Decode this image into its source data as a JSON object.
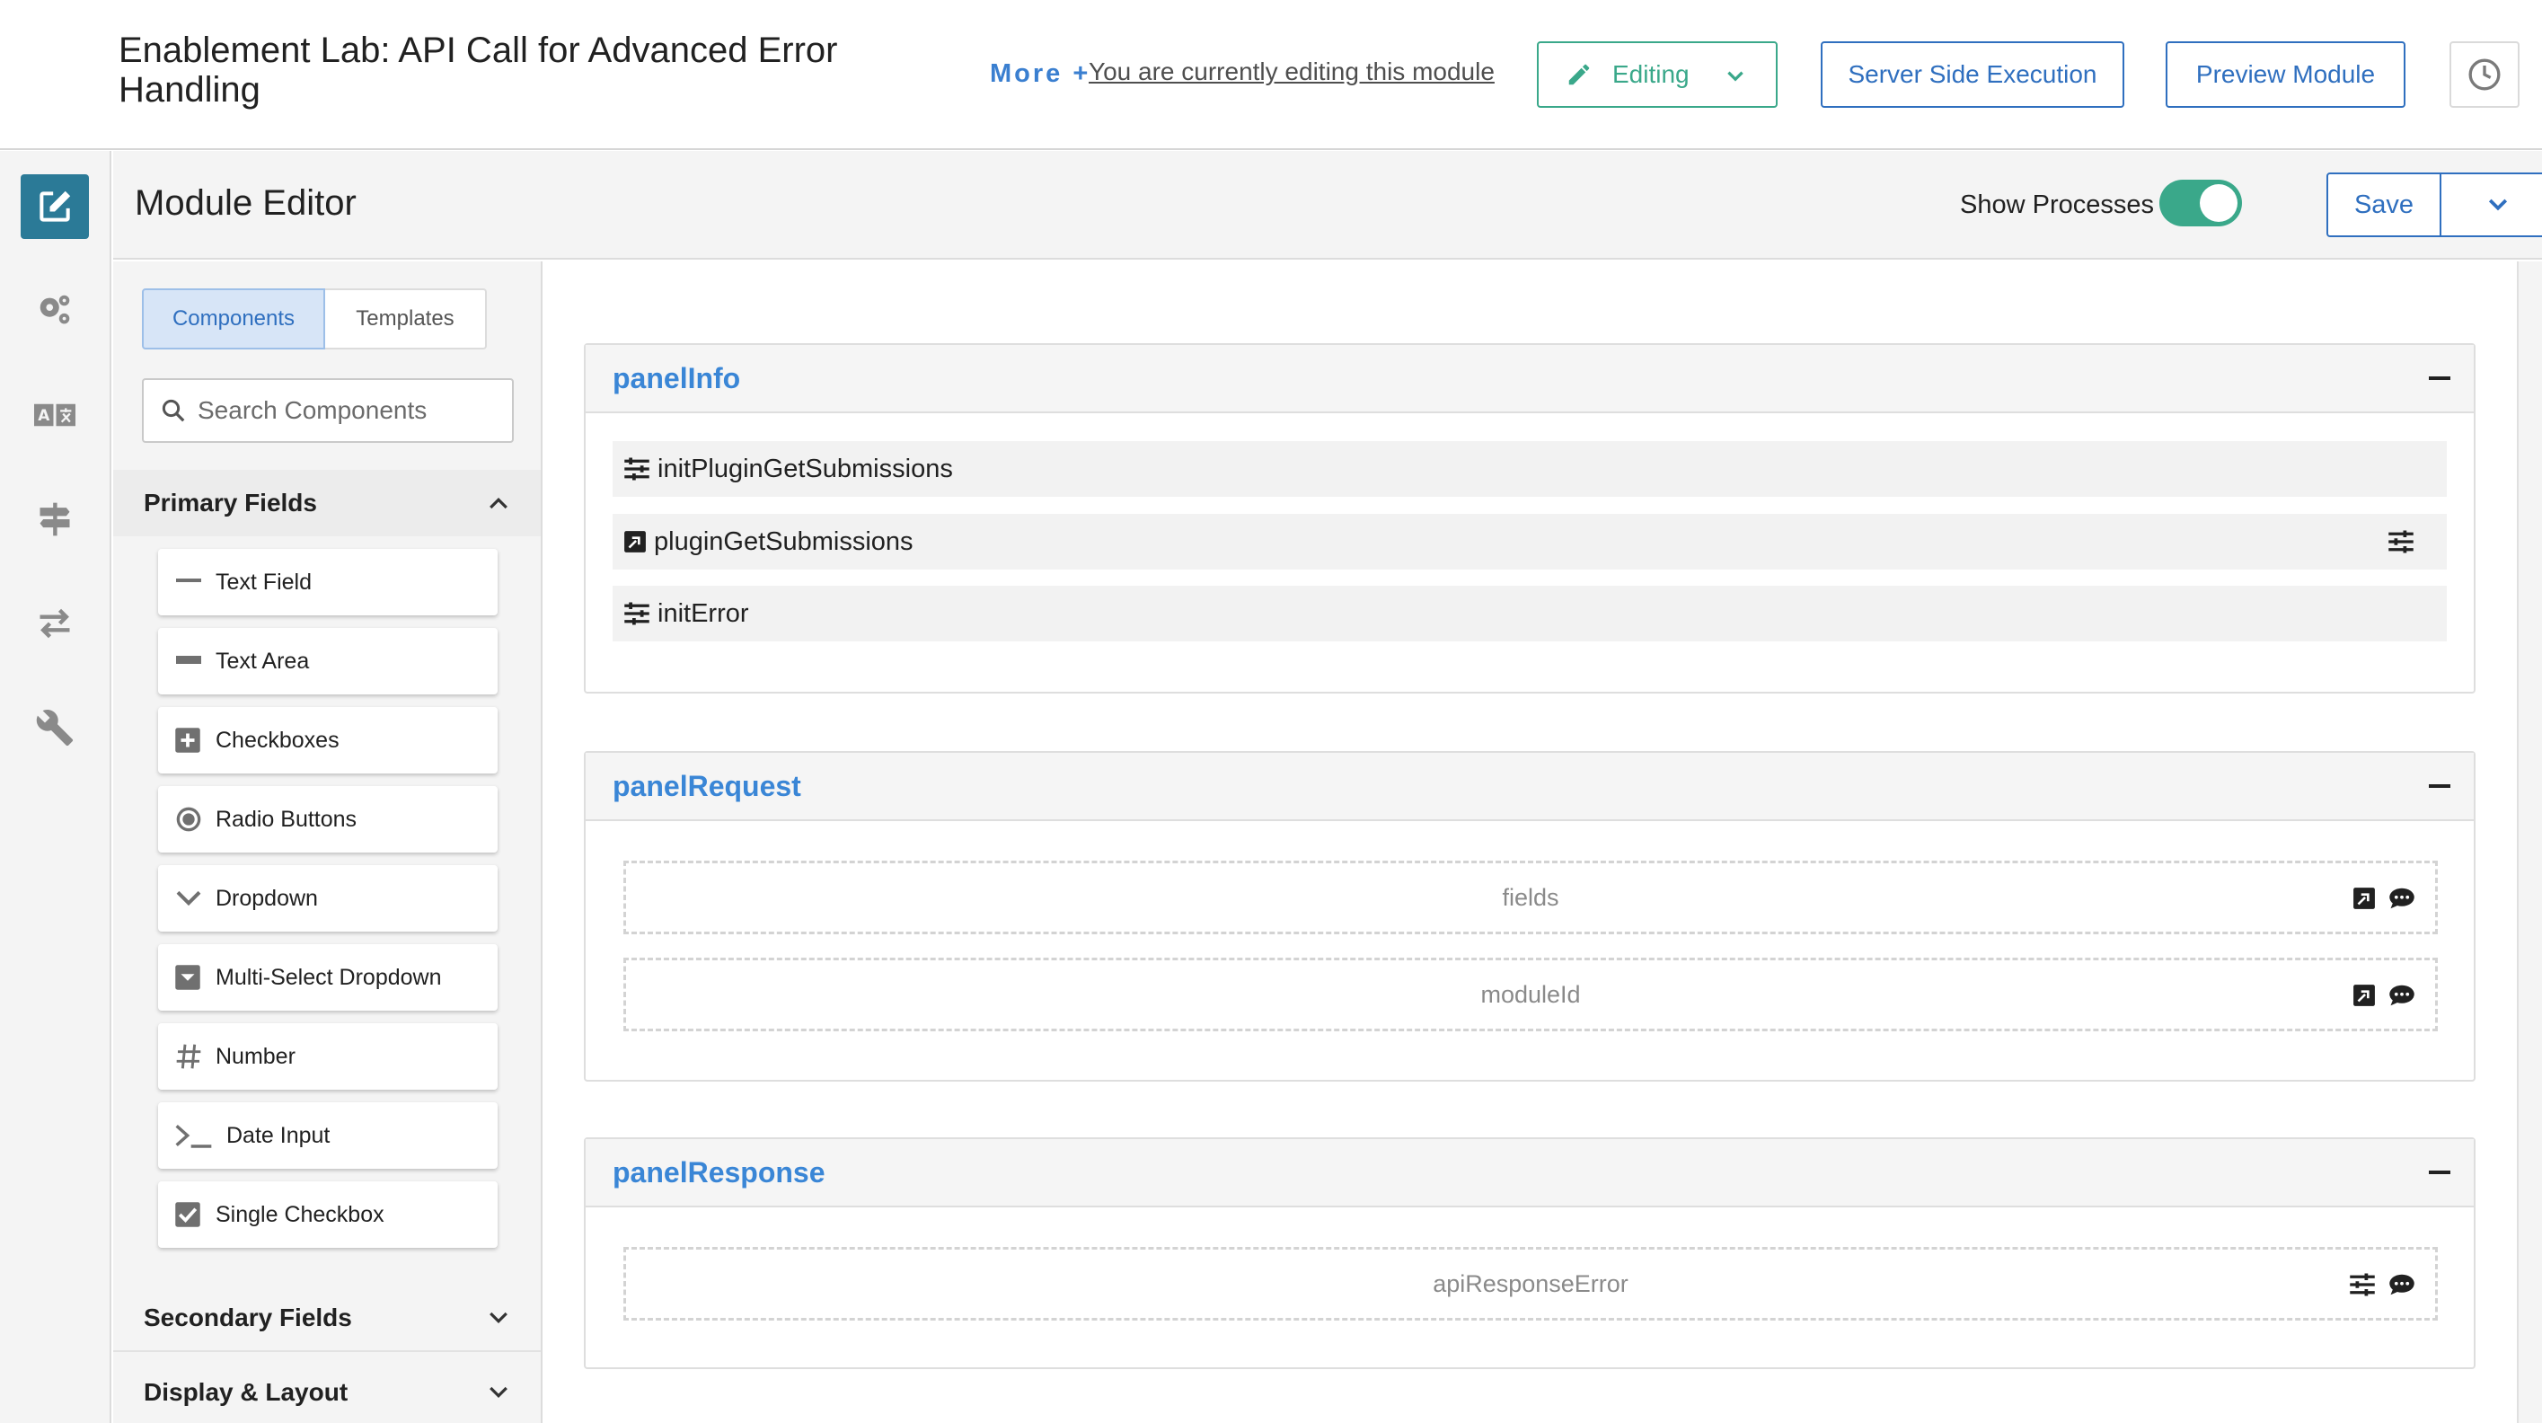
{
  "header": {
    "title": "Enablement Lab: API Call for Advanced Error Handling",
    "more_label": "More +",
    "editing_note": "You are currently editing this module",
    "editing_label": "Editing",
    "server_side_label": "Server Side Execution",
    "preview_label": "Preview Module"
  },
  "rail": {
    "icons": [
      "edit-icon",
      "gears-icon",
      "translate-icon",
      "signpost-icon",
      "transfer-arrows-icon",
      "wrench-icon"
    ]
  },
  "editor": {
    "title": "Module Editor",
    "show_processes_label": "Show Processes",
    "show_processes_on": true,
    "save_label": "Save"
  },
  "sidebar": {
    "tabs": [
      "Components",
      "Templates"
    ],
    "active_tab": "Components",
    "search_placeholder": "Search Components",
    "primary_section": "Primary Fields",
    "components": [
      {
        "label": "Text Field",
        "icon": "text-field-icon"
      },
      {
        "label": "Text Area",
        "icon": "text-area-icon"
      },
      {
        "label": "Checkboxes",
        "icon": "checkboxes-icon"
      },
      {
        "label": "Radio Buttons",
        "icon": "radio-buttons-icon"
      },
      {
        "label": "Dropdown",
        "icon": "dropdown-icon"
      },
      {
        "label": "Multi-Select Dropdown",
        "icon": "multi-select-icon"
      },
      {
        "label": "Number",
        "icon": "hash-icon"
      },
      {
        "label": "Date Input",
        "icon": "terminal-icon"
      },
      {
        "label": "Single Checkbox",
        "icon": "checked-box-icon"
      }
    ],
    "secondary_section": "Secondary Fields",
    "display_section": "Display & Layout"
  },
  "canvas": {
    "panels": [
      {
        "title": "panelInfo",
        "rows": [
          {
            "label": "initPluginGetSubmissions",
            "icon": "sliders-icon"
          },
          {
            "label": "pluginGetSubmissions",
            "icon": "plugin-icon",
            "right_icon": "sliders-icon"
          },
          {
            "label": "initError",
            "icon": "sliders-icon"
          }
        ]
      },
      {
        "title": "panelRequest",
        "fields": [
          {
            "label": "fields",
            "icons": [
              "plugin-icon",
              "comment-icon"
            ]
          },
          {
            "label": "moduleId",
            "icons": [
              "plugin-icon",
              "comment-icon"
            ]
          }
        ]
      },
      {
        "title": "panelResponse",
        "fields": [
          {
            "label": "apiResponseError",
            "icons": [
              "sliders-icon",
              "comment-icon"
            ]
          }
        ]
      }
    ]
  },
  "colors": {
    "accent_blue": "#2f6fbf",
    "panel_title_blue": "#3a86d6",
    "green": "#3aa88a",
    "rail_active": "#2b7a97"
  }
}
